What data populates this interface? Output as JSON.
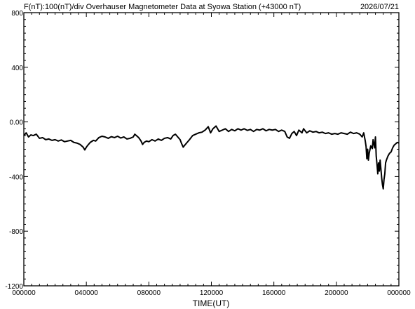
{
  "header": {
    "left": "F(nT):100(nT)/div  Overhauser Magnetometer Data at Syowa Station (+43000 nT)",
    "date": "2026/07/21"
  },
  "chart_data": {
    "type": "line",
    "title": "F(nT):100(nT)/div  Overhauser Magnetometer Data at Syowa Station (+43000 nT)",
    "xlabel": "TIME(UT)",
    "ylabel": "",
    "xlim": [
      0,
      24
    ],
    "ylim": [
      -1200,
      800
    ],
    "grid": false,
    "x_ticks": [
      {
        "x": 0,
        "label": "000000"
      },
      {
        "x": 4,
        "label": "040000"
      },
      {
        "x": 8,
        "label": "080000"
      },
      {
        "x": 12,
        "label": "120000"
      },
      {
        "x": 16,
        "label": "160000"
      },
      {
        "x": 20,
        "label": "200000"
      },
      {
        "x": 24,
        "label": "000000"
      }
    ],
    "y_ticks": [
      {
        "y": 800,
        "label": "800"
      },
      {
        "y": 400,
        "label": "400"
      },
      {
        "y": 0,
        "label": "0.00"
      },
      {
        "y": -400,
        "label": "-400"
      },
      {
        "y": -800,
        "label": "-800"
      },
      {
        "y": -1200,
        "label": "-1200"
      }
    ],
    "x_minor_step": 0.5,
    "y_minor_step": 50,
    "series": [
      {
        "color": "#000000",
        "points": [
          [
            0.0,
            -100
          ],
          [
            0.15,
            -80
          ],
          [
            0.3,
            -110
          ],
          [
            0.45,
            -95
          ],
          [
            0.6,
            -100
          ],
          [
            0.8,
            -90
          ],
          [
            1.0,
            -120
          ],
          [
            1.2,
            -115
          ],
          [
            1.4,
            -130
          ],
          [
            1.6,
            -125
          ],
          [
            1.8,
            -135
          ],
          [
            2.0,
            -130
          ],
          [
            2.2,
            -140
          ],
          [
            2.4,
            -132
          ],
          [
            2.6,
            -145
          ],
          [
            2.8,
            -140
          ],
          [
            3.0,
            -135
          ],
          [
            3.2,
            -150
          ],
          [
            3.4,
            -155
          ],
          [
            3.6,
            -165
          ],
          [
            3.8,
            -185
          ],
          [
            3.9,
            -205
          ],
          [
            4.0,
            -185
          ],
          [
            4.1,
            -170
          ],
          [
            4.25,
            -150
          ],
          [
            4.45,
            -135
          ],
          [
            4.6,
            -140
          ],
          [
            4.8,
            -115
          ],
          [
            5.0,
            -105
          ],
          [
            5.2,
            -110
          ],
          [
            5.4,
            -120
          ],
          [
            5.6,
            -108
          ],
          [
            5.8,
            -115
          ],
          [
            6.0,
            -105
          ],
          [
            6.2,
            -118
          ],
          [
            6.4,
            -110
          ],
          [
            6.6,
            -125
          ],
          [
            6.8,
            -120
          ],
          [
            7.0,
            -110
          ],
          [
            7.1,
            -90
          ],
          [
            7.2,
            -100
          ],
          [
            7.35,
            -115
          ],
          [
            7.5,
            -140
          ],
          [
            7.6,
            -165
          ],
          [
            7.7,
            -150
          ],
          [
            7.85,
            -140
          ],
          [
            8.0,
            -145
          ],
          [
            8.2,
            -130
          ],
          [
            8.4,
            -140
          ],
          [
            8.6,
            -125
          ],
          [
            8.8,
            -135
          ],
          [
            9.0,
            -120
          ],
          [
            9.2,
            -115
          ],
          [
            9.4,
            -125
          ],
          [
            9.55,
            -100
          ],
          [
            9.7,
            -90
          ],
          [
            9.85,
            -110
          ],
          [
            10.0,
            -130
          ],
          [
            10.1,
            -160
          ],
          [
            10.2,
            -185
          ],
          [
            10.3,
            -170
          ],
          [
            10.45,
            -150
          ],
          [
            10.6,
            -130
          ],
          [
            10.8,
            -100
          ],
          [
            11.0,
            -90
          ],
          [
            11.2,
            -80
          ],
          [
            11.4,
            -75
          ],
          [
            11.6,
            -60
          ],
          [
            11.8,
            -35
          ],
          [
            11.95,
            -80
          ],
          [
            12.1,
            -50
          ],
          [
            12.3,
            -30
          ],
          [
            12.5,
            -70
          ],
          [
            12.7,
            -60
          ],
          [
            12.9,
            -50
          ],
          [
            13.1,
            -70
          ],
          [
            13.3,
            -55
          ],
          [
            13.5,
            -65
          ],
          [
            13.7,
            -50
          ],
          [
            13.9,
            -60
          ],
          [
            14.1,
            -50
          ],
          [
            14.3,
            -62
          ],
          [
            14.5,
            -55
          ],
          [
            14.7,
            -70
          ],
          [
            14.9,
            -55
          ],
          [
            15.1,
            -60
          ],
          [
            15.3,
            -50
          ],
          [
            15.5,
            -65
          ],
          [
            15.7,
            -55
          ],
          [
            15.9,
            -60
          ],
          [
            16.1,
            -55
          ],
          [
            16.3,
            -70
          ],
          [
            16.5,
            -60
          ],
          [
            16.7,
            -70
          ],
          [
            16.85,
            -110
          ],
          [
            17.0,
            -120
          ],
          [
            17.15,
            -85
          ],
          [
            17.3,
            -70
          ],
          [
            17.45,
            -100
          ],
          [
            17.6,
            -60
          ],
          [
            17.8,
            -80
          ],
          [
            17.9,
            -50
          ],
          [
            18.1,
            -80
          ],
          [
            18.3,
            -65
          ],
          [
            18.5,
            -75
          ],
          [
            18.7,
            -70
          ],
          [
            18.9,
            -80
          ],
          [
            19.1,
            -75
          ],
          [
            19.3,
            -85
          ],
          [
            19.5,
            -80
          ],
          [
            19.7,
            -90
          ],
          [
            19.9,
            -85
          ],
          [
            20.1,
            -90
          ],
          [
            20.3,
            -80
          ],
          [
            20.5,
            -85
          ],
          [
            20.7,
            -90
          ],
          [
            20.9,
            -75
          ],
          [
            21.1,
            -85
          ],
          [
            21.3,
            -80
          ],
          [
            21.5,
            -90
          ],
          [
            21.65,
            -110
          ],
          [
            21.75,
            -80
          ],
          [
            21.85,
            -140
          ],
          [
            21.9,
            -180
          ],
          [
            21.95,
            -270
          ],
          [
            22.0,
            -200
          ],
          [
            22.05,
            -280
          ],
          [
            22.1,
            -230
          ],
          [
            22.2,
            -175
          ],
          [
            22.3,
            -195
          ],
          [
            22.35,
            -130
          ],
          [
            22.45,
            -190
          ],
          [
            22.5,
            -110
          ],
          [
            22.55,
            -250
          ],
          [
            22.6,
            -310
          ],
          [
            22.65,
            -380
          ],
          [
            22.7,
            -300
          ],
          [
            22.75,
            -360
          ],
          [
            22.8,
            -280
          ],
          [
            22.9,
            -410
          ],
          [
            22.95,
            -460
          ],
          [
            23.0,
            -490
          ],
          [
            23.05,
            -420
          ],
          [
            23.1,
            -380
          ],
          [
            23.15,
            -300
          ],
          [
            23.2,
            -280
          ],
          [
            23.3,
            -250
          ],
          [
            23.4,
            -230
          ],
          [
            23.5,
            -220
          ],
          [
            23.6,
            -190
          ],
          [
            23.7,
            -170
          ],
          [
            23.8,
            -160
          ],
          [
            23.9,
            -150
          ],
          [
            24.0,
            -155
          ]
        ]
      }
    ]
  }
}
